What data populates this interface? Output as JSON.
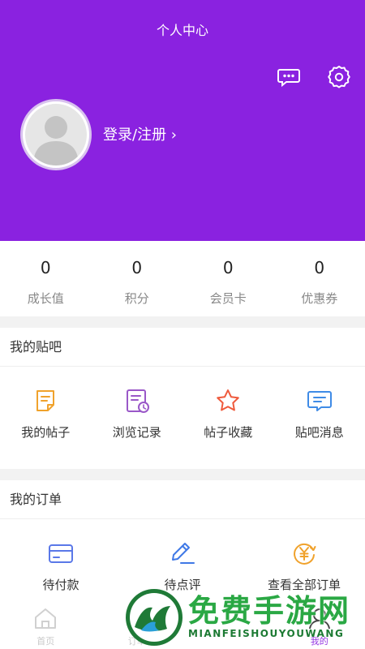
{
  "header": {
    "title": "个人中心",
    "login_label": "登录/注册 ›",
    "bg_color": "#8a22e0",
    "icons": [
      "chat-bubble-icon",
      "gear-icon"
    ]
  },
  "stats": [
    {
      "value": "0",
      "label": "成长值"
    },
    {
      "value": "0",
      "label": "积分"
    },
    {
      "value": "0",
      "label": "会员卡"
    },
    {
      "value": "0",
      "label": "优惠券"
    }
  ],
  "tieba": {
    "title": "我的贴吧",
    "items": [
      {
        "label": "我的帖子",
        "icon": "post-document-icon",
        "color": "#f0a22c"
      },
      {
        "label": "浏览记录",
        "icon": "history-icon",
        "color": "#9a58c8"
      },
      {
        "label": "帖子收藏",
        "icon": "star-icon",
        "color": "#ef5a3c"
      },
      {
        "label": "贴吧消息",
        "icon": "message-icon",
        "color": "#3f8be6"
      }
    ]
  },
  "orders": {
    "title": "我的订单",
    "items": [
      {
        "label": "待付款",
        "icon": "card-icon",
        "color": "#5a78e8"
      },
      {
        "label": "待点评",
        "icon": "pen-icon",
        "color": "#3f78e6"
      },
      {
        "label": "查看全部订单",
        "icon": "yen-coin-icon",
        "color": "#f0a22c"
      }
    ]
  },
  "tabbar": [
    {
      "label": "首页",
      "icon": "home-icon"
    },
    {
      "label": "订单",
      "icon": "order-icon"
    },
    {
      "label": "",
      "icon": "blank"
    },
    {
      "label": "我的",
      "icon": "user-icon"
    }
  ],
  "watermark": {
    "cn": "免费手游网",
    "en": "MIANFEISHOUYOUWANG"
  }
}
